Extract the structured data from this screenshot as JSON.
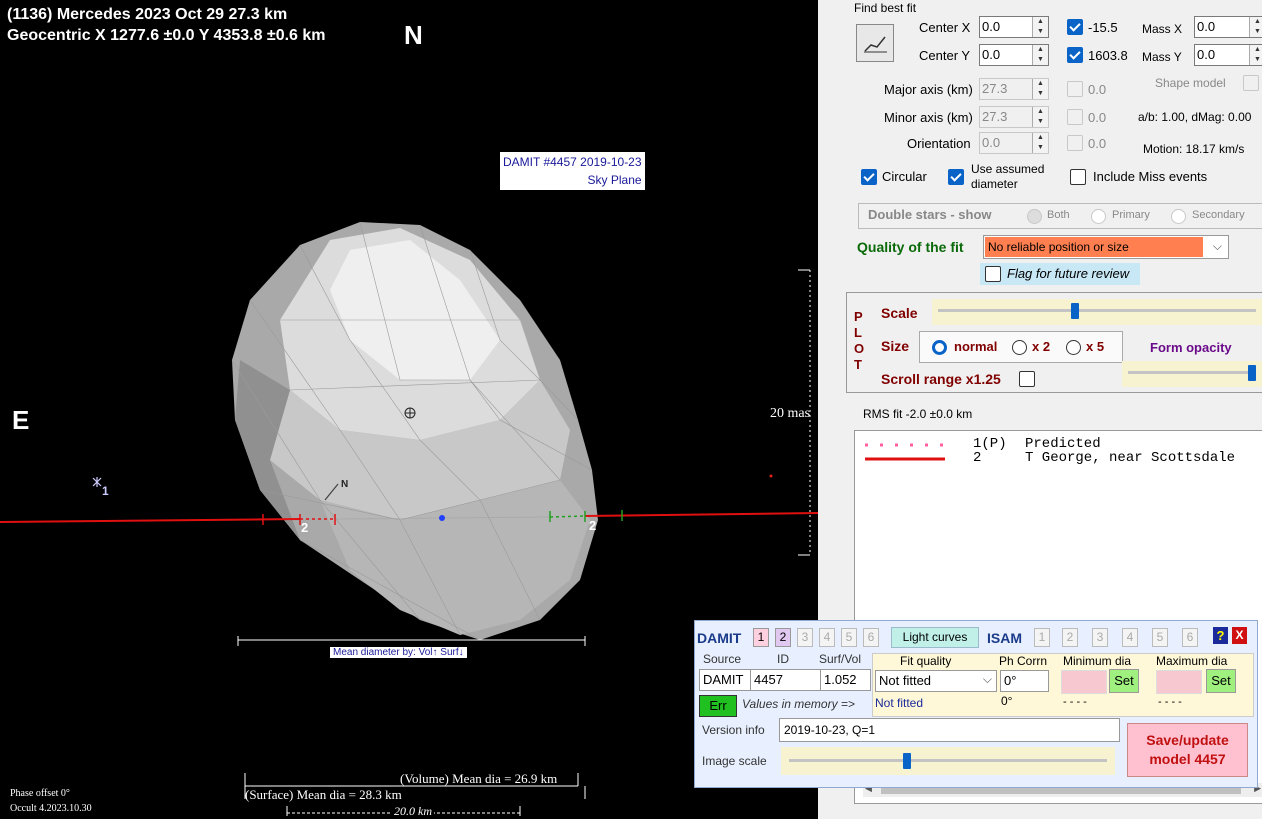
{
  "plot": {
    "title_line1": "(1136) Mercedes  2023 Oct 29  27.3 km",
    "title_line2": "Geocentric  X  1277.6 ±0.0  Y 4353.8 ±0.6 km",
    "north_label": "N",
    "east_label": "E",
    "damit_label_line1": "DAMIT #4457 2019-10-23",
    "damit_label_line2": "Sky Plane",
    "scale_label": "20 mas",
    "chord_label_left": "2",
    "chord_label_right": "2",
    "star_label": "1",
    "small_north": "N",
    "mean_diameter_caption": "Mean diameter by: Vol↑ Surf↓",
    "volume_mean": "(Volume) Mean dia = 26.9 km",
    "surface_mean": "(Surface) Mean dia = 28.3 km",
    "scale_bar_km": "20.0 km",
    "phase_offset": "Phase offset 0°",
    "version": "Occult 4.2023.10.30",
    "colors": {
      "chord": "#e01010",
      "background": "#000000",
      "shape": "#cfcfcf"
    }
  },
  "fit": {
    "find_best_fit": "Find best fit",
    "center_x_label": "Center X",
    "center_x_value": "0.0",
    "center_x_result": "-15.5",
    "center_y_label": "Center Y",
    "center_y_value": "0.0",
    "center_y_result": "1603.8",
    "mass_x_label": "Mass X",
    "mass_x_value": "0.0",
    "mass_y_label": "Mass Y",
    "mass_y_value": "0.0",
    "major_axis_label": "Major axis (km)",
    "major_axis_value": "27.3",
    "major_axis_result": "0.0",
    "minor_axis_label": "Minor axis (km)",
    "minor_axis_value": "27.3",
    "minor_axis_result": "0.0",
    "orientation_label": "Orientation",
    "orientation_value": "0.0",
    "orientation_result": "0.0",
    "shape_model_label": "Shape model",
    "ab_text": "a/b: 1.00, dMag: 0.00",
    "motion_text": "Motion: 18.17 km/s",
    "circular_label": "Circular",
    "use_assumed_label_1": "Use assumed",
    "use_assumed_label_2": "diameter",
    "include_miss_label": "Include Miss events",
    "double_stars_label": "Double stars - show",
    "both_label": "Both",
    "primary_label": "Primary",
    "secondary_label": "Secondary",
    "quality_label": "Quality of the fit",
    "quality_value": "No reliable position or size",
    "flag_label": "Flag for future review"
  },
  "plotctl": {
    "plot_letters": [
      "P",
      "L",
      "O",
      "T"
    ],
    "scale_label": "Scale",
    "size_label": "Size",
    "normal_label": "normal",
    "x2_label": "x 2",
    "x5_label": "x 5",
    "form_opacity_label": "Form opacity",
    "scroll_range_label": "Scroll range x1.25",
    "scale_level": 0.43,
    "opacity_level": 0.97
  },
  "rms": {
    "text": "RMS fit -2.0 ±0.0 km",
    "legend": [
      {
        "num": "1(P)",
        "name": "Predicted",
        "style": "dotted",
        "color": "#ff60a0"
      },
      {
        "num": "2",
        "name": "T George, near Scottsdale",
        "style": "solid",
        "color": "#e01010"
      }
    ]
  },
  "damit": {
    "title": "DAMIT",
    "nums": [
      "1",
      "2",
      "3",
      "4",
      "5",
      "6"
    ],
    "light_curves": "Light curves",
    "isam": "ISAM",
    "isam_nums": [
      "1",
      "2",
      "3",
      "4",
      "5",
      "6"
    ],
    "help": "?",
    "close": "X",
    "source_label": "Source",
    "id_label": "ID",
    "surfvol_label": "Surf/Vol",
    "source_value": "DAMIT",
    "id_value": "4457",
    "surfvol_value": "1.052",
    "err_label": "Err",
    "values_memory": "Values in memory =>",
    "fit_quality_label": "Fit quality",
    "fit_quality_value": "Not fitted",
    "fit_quality_mem": "Not fitted",
    "ph_corrn_label": "Ph Corrn",
    "ph_corrn_value": "0°",
    "ph_corrn_mem": "0°",
    "min_dia_label": "Minimum dia",
    "max_dia_label": "Maximum dia",
    "set_label": "Set",
    "dashes": "- - - -",
    "version_label": "Version info",
    "version_value": "2019-10-23, Q=1",
    "image_scale_label": "Image scale",
    "save_line1": "Save/update",
    "save_line2": "model 4457",
    "image_scale_level": 0.37
  }
}
